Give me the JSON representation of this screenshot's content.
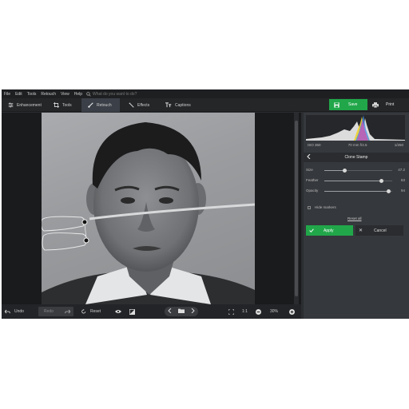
{
  "menubar": {
    "items": [
      "File",
      "Edit",
      "Tools",
      "Retouch",
      "View",
      "Help"
    ],
    "search_placeholder": "What do you want to do?"
  },
  "toolbar": {
    "tabs": [
      {
        "label": "Enhancement",
        "icon": "sliders-icon"
      },
      {
        "label": "Tools",
        "icon": "crop-icon"
      },
      {
        "label": "Retouch",
        "icon": "brush-icon",
        "active": true
      },
      {
        "label": "Effects",
        "icon": "magic-wand-icon"
      },
      {
        "label": "Captions",
        "icon": "text-icon"
      }
    ],
    "save_label": "Save",
    "print_label": "Print",
    "accent_color": "#21a74a"
  },
  "bottombar": {
    "undo_label": "Undo",
    "redo_label": "Redo",
    "reset_label": "Reset",
    "zoom_1to1": "1:1",
    "zoom_value": "30%"
  },
  "panel": {
    "exif": {
      "iso": "ISO 360",
      "lens": "70 mm f/4.5",
      "shutter": "1/250"
    },
    "clone_stamp": {
      "title": "Clone Stamp",
      "size": {
        "label": "Size",
        "value": "47.2",
        "fraction": 0.29
      },
      "feather": {
        "label": "Feather",
        "value": "83",
        "fraction": 0.83
      },
      "opacity": {
        "label": "Opacity",
        "value": "94",
        "fraction": 0.94
      },
      "hide_markers_label": "Hide markers",
      "hide_markers_checked": false,
      "reset_all_label": "Reset all",
      "apply_label": "Apply",
      "cancel_label": "Cancel"
    }
  }
}
